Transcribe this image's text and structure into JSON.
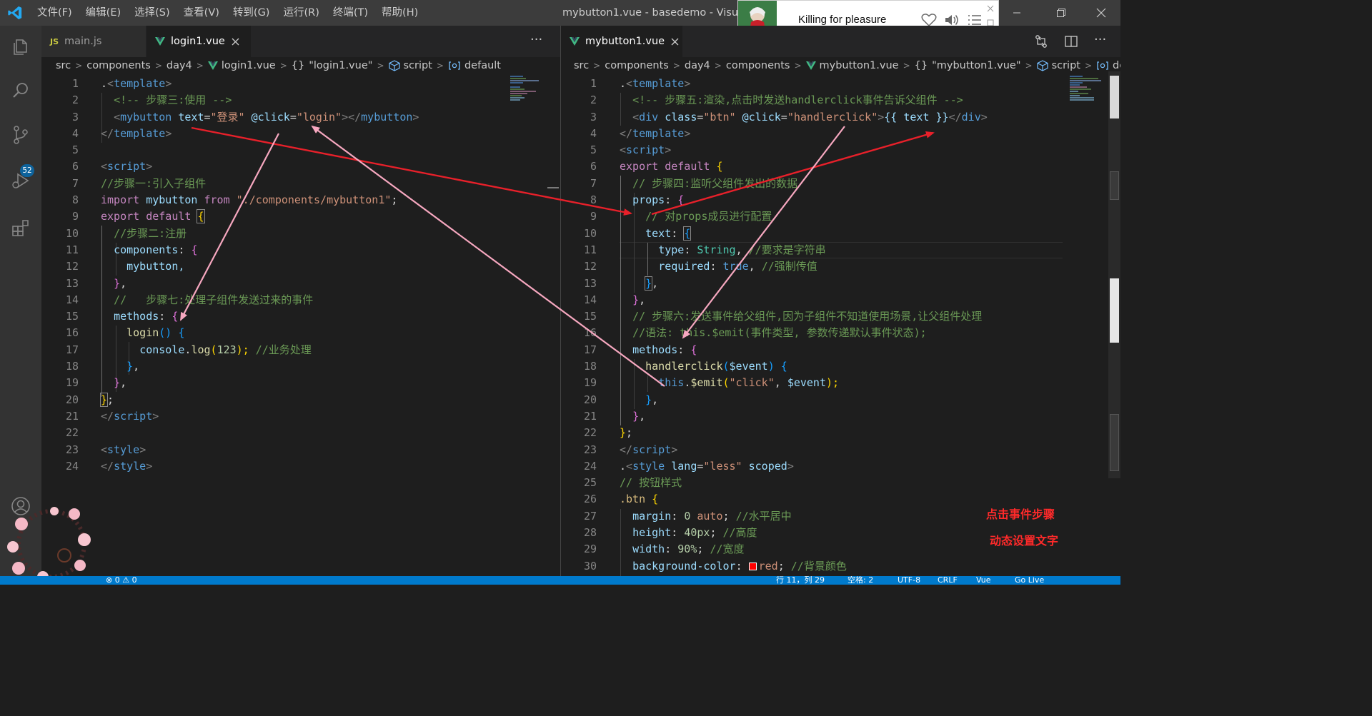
{
  "menu": {
    "items": [
      "文件(F)",
      "编辑(E)",
      "选择(S)",
      "查看(V)",
      "转到(G)",
      "运行(R)",
      "终端(T)",
      "帮助(H)"
    ]
  },
  "window": {
    "title": "mybutton1.vue - basedemo - Visual Studio Code"
  },
  "music": {
    "title": "Killing for pleasure"
  },
  "activity": {
    "scm_badge": "52"
  },
  "left": {
    "tabs": [
      "main.js",
      "login1.vue"
    ],
    "more": "···",
    "breadcrumb": [
      "src",
      "components",
      "day4",
      "login1.vue",
      "{}",
      "\"login1.vue\"",
      "script",
      "default"
    ],
    "line_numbers": [
      "1",
      "2",
      "3",
      "4",
      "5",
      "6",
      "7",
      "8",
      "9",
      "10",
      "11",
      "12",
      "13",
      "14",
      "15",
      "16",
      "17",
      "18",
      "19",
      "20",
      "21",
      "22",
      "23",
      "24"
    ],
    "code": {
      "l1_a": ".",
      "l1_b": "<",
      "l1_c": "template",
      "l1_d": ">",
      "l2": "<!-- 步骤三:使用 -->",
      "l3_open": "<",
      "l3_tag": "mybutton",
      "l3_attr1": "text",
      "l3_eq1": "=",
      "l3_val1": "\"登录\"",
      "l3_attr2": "@click",
      "l3_eq2": "=",
      "l3_val2": "\"login\"",
      "l3_close": "></",
      "l3_tag2": "mybutton",
      "l3_end": ">",
      "l4_a": "</",
      "l4_b": "template",
      "l4_c": ">",
      "l6_a": "<",
      "l6_b": "script",
      "l6_c": ">",
      "l7": "//步骤一:引入子组件",
      "l8_import": "import",
      "l8_name": "mybutton",
      "l8_from": "from",
      "l8_path": "\"./components/mybutton1\"",
      "l8_semi": ";",
      "l9_export": "export",
      "l9_default": "default",
      "l9_brace": "{",
      "l10": "//步骤二:注册",
      "l11_key": "components",
      "l11_colon": ":",
      "l11_brace": "{",
      "l12": "mybutton,",
      "l13_brace": "}",
      "l13_comma": ",",
      "l14": "//   步骤七:处理子组件发送过来的事件",
      "l15_key": "methods",
      "l15_colon": ":",
      "l15_brace": "{",
      "l16_fn": "login",
      "l16_paren": "()",
      "l16_brace": "{",
      "l17_obj": "console",
      "l17_dot": ".",
      "l17_fn": "log",
      "l17_p1": "(",
      "l17_num": "123",
      "l17_p2": ");",
      "l17_com": "//业务处理",
      "l18_brace": "}",
      "l18_comma": ",",
      "l19_brace": "}",
      "l19_comma": ",",
      "l20_brace": "}",
      "l20_semi": ";",
      "l21_a": "</",
      "l21_b": "script",
      "l21_c": ">",
      "l23_a": "<",
      "l23_b": "style",
      "l23_c": ">",
      "l24_a": "</",
      "l24_b": "style",
      "l24_c": ">"
    }
  },
  "right": {
    "tabs": [
      "mybutton1.vue"
    ],
    "breadcrumb": [
      "src",
      "components",
      "day4",
      "components",
      "mybutton1.vue",
      "{}",
      "\"mybutton1.vue\"",
      "script",
      "de"
    ],
    "line_numbers": [
      "1",
      "2",
      "3",
      "4",
      "5",
      "6",
      "7",
      "8",
      "9",
      "10",
      "11",
      "12",
      "13",
      "14",
      "15",
      "16",
      "17",
      "18",
      "19",
      "20",
      "21",
      "22",
      "23",
      "24",
      "25",
      "26",
      "27",
      "28",
      "29",
      "30"
    ],
    "code": {
      "r1_a": ".",
      "r1_b": "<",
      "r1_c": "template",
      "r1_d": ">",
      "r2": "<!-- 步骤五:渲染,点击时发送handlerclick事件告诉父组件 -->",
      "r3_open": "<",
      "r3_tag": "div",
      "r3_attr1": "class",
      "r3_eq1": "=",
      "r3_val1": "\"btn\"",
      "r3_attr2": "@click",
      "r3_eq2": "=",
      "r3_val2": "\"handlerclick\"",
      "r3_gt": ">",
      "r3_mus": "{{ text }}",
      "r3_close": "</",
      "r3_tag2": "div",
      "r3_end": ">",
      "r4_a": "</",
      "r4_b": "template",
      "r4_c": ">",
      "r5_a": "<",
      "r5_b": "script",
      "r5_c": ">",
      "r6_export": "export",
      "r6_default": "default",
      "r6_brace": "{",
      "r7": "// 步骤四:监听父组件发出的数据",
      "r8_key": "props",
      "r8_colon": ":",
      "r8_brace": "{",
      "r9": "// 对props成员进行配置",
      "r10_key": "text",
      "r10_colon": ":",
      "r10_brace": "{",
      "r11_key": "type",
      "r11_colon": ":",
      "r11_val": "String",
      "r11_comma": ",",
      "r11_com": "//要求是字符串",
      "r12_key": "required",
      "r12_colon": ":",
      "r12_val": "true",
      "r12_comma": ",",
      "r12_com": "//强制传值",
      "r13_brace": "}",
      "r13_comma": ",",
      "r14_brace": "}",
      "r14_comma": ",",
      "r15": "// 步骤六:发送事件给父组件,因为子组件不知道使用场景,让父组件处理",
      "r16": "//语法: this.$emit(事件类型, 参数传递默认事件状态);",
      "r17_key": "methods",
      "r17_colon": ":",
      "r17_brace": "{",
      "r18_fn": "handlerclick",
      "r18_p1": "(",
      "r18_arg": "$event",
      "r18_p2": ")",
      "r18_brace": "{",
      "r19_this": "this",
      "r19_dot": ".",
      "r19_fn": "$emit",
      "r19_p1": "(",
      "r19_str": "\"click\"",
      "r19_comma": ",",
      "r19_arg": "$event",
      "r19_p2": ");",
      "r20_brace": "}",
      "r20_comma": ",",
      "r21_brace": "}",
      "r21_comma": ",",
      "r22_brace": "}",
      "r22_semi": ";",
      "r23_a": "</",
      "r23_b": "script",
      "r23_c": ">",
      "r24_a": ".",
      "r24_b": "<",
      "r24_c": "style",
      "r24_attr": "lang",
      "r24_eq": "=",
      "r24_val": "\"less\"",
      "r24_attr2": "scoped",
      "r24_d": ">",
      "r25": "// 按钮样式",
      "r26_sel": ".btn",
      "r26_brace": "{",
      "r27_prop": "margin",
      "r27_colon": ":",
      "r27_v1": "0",
      "r27_v2": "auto",
      "r27_semi": ";",
      "r27_com": "//水平居中",
      "r28_prop": "height",
      "r28_colon": ":",
      "r28_val": "40px",
      "r28_semi": ";",
      "r28_com": "//高度",
      "r29_prop": "width",
      "r29_colon": ":",
      "r29_val": "90%",
      "r29_semi": ";",
      "r29_com": "//宽度",
      "r30_prop": "background-color",
      "r30_colon": ":",
      "r30_val": "red",
      "r30_semi": ";",
      "r30_com": "//背景颜色"
    },
    "overlay_1": "点击事件步骤",
    "overlay_2": "动态设置文字"
  },
  "status": {
    "left_items": [
      "⊗ 0 ⚠ 0"
    ],
    "right_items": [
      "行 11，列 29",
      "空格: 2",
      "UTF-8",
      "CRLF",
      "Vue",
      "Go Live"
    ]
  },
  "colors": {
    "accent": "#007acc",
    "arrow_red": "#e8202a",
    "arrow_pink": "#f7a8c0",
    "overlay_text": "#ff2a2a"
  }
}
